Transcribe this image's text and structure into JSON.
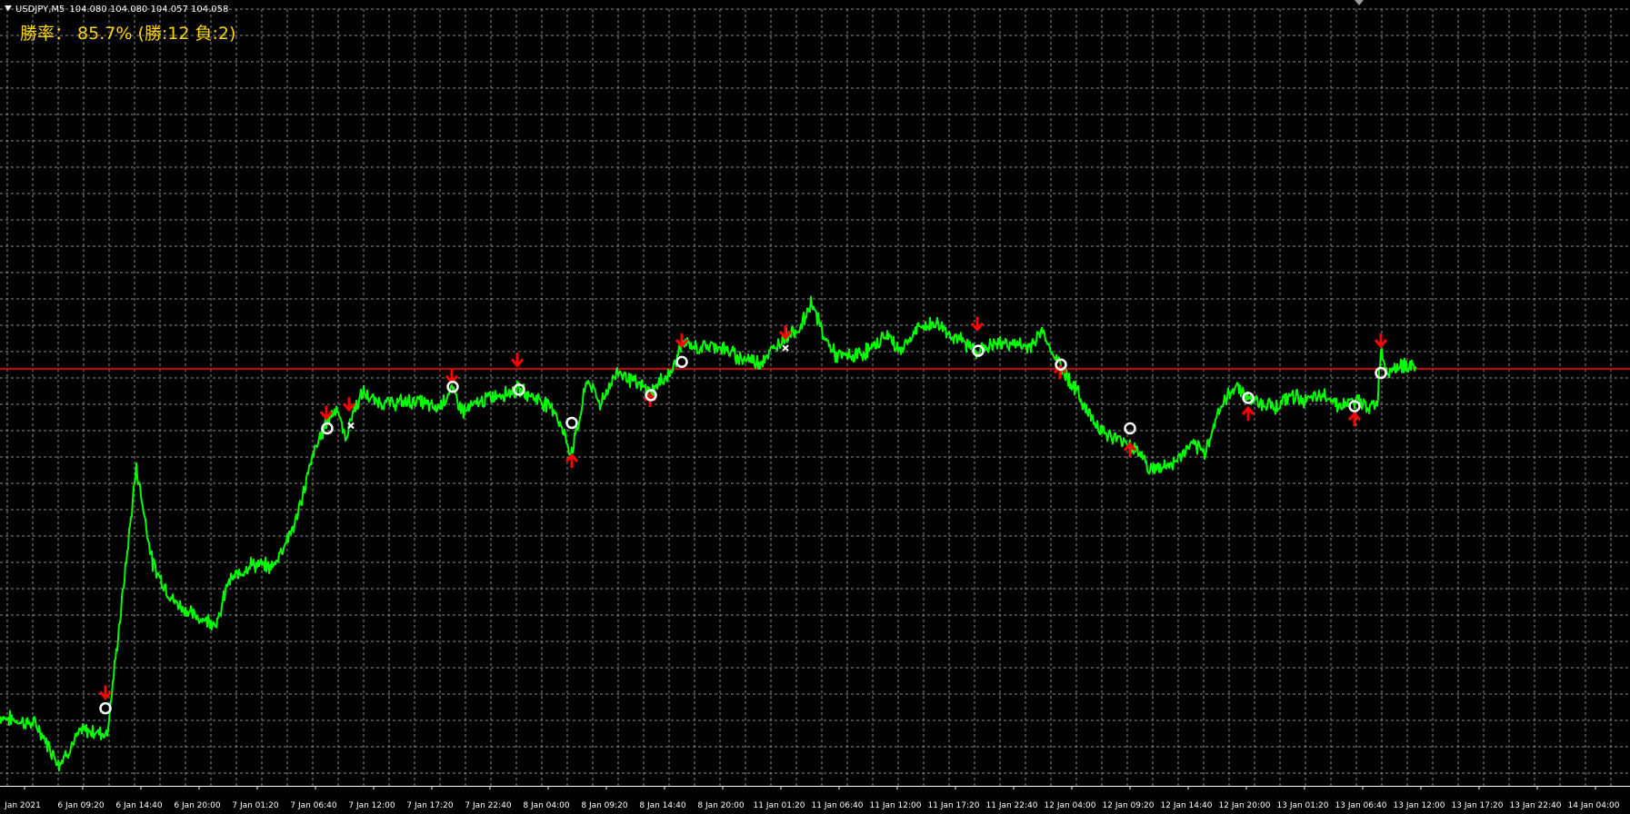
{
  "window": {
    "symbol_label": "USDJPY,M5",
    "ohlc_label": "104.080 104.080 104.057 104.058"
  },
  "overlay": {
    "win_rate_text": "勝率： 85.7% (勝:12  負:2)"
  },
  "colors": {
    "background": "#000000",
    "grid": "#8c8c8c",
    "price_line": "#00ff00",
    "bid_line": "#c80000",
    "sell_arrow": "#ff0000",
    "buy_arrow": "#ff0000",
    "win_marker": "#ffffff",
    "loss_marker": "#ffffff",
    "title_text": "#ffffff",
    "winrate_text": "#ffd700",
    "axis_text": "#ffffff"
  },
  "chart_data": {
    "type": "line",
    "symbol": "USDJPY",
    "timeframe": "M5",
    "x_tick_labels": [
      "Jan 2021",
      "6 Jan 09:20",
      "6 Jan 14:40",
      "6 Jan 20:00",
      "7 Jan 01:20",
      "7 Jan 06:40",
      "7 Jan 12:00",
      "7 Jan 17:20",
      "7 Jan 22:40",
      "8 Jan 04:00",
      "8 Jan 09:20",
      "8 Jan 14:40",
      "8 Jan 20:00",
      "11 Jan 01:20",
      "11 Jan 06:40",
      "11 Jan 12:00",
      "11 Jan 17:20",
      "11 Jan 22:40",
      "12 Jan 04:00",
      "12 Jan 09:20",
      "12 Jan 14:40",
      "12 Jan 20:00",
      "13 Jan 01:20",
      "13 Jan 06:40",
      "13 Jan 12:00",
      "13 Jan 17:20",
      "13 Jan 22:40",
      "14 Jan 04:00"
    ],
    "y_scale": {
      "min": 102.55,
      "max": 104.35,
      "bid": 104.058
    },
    "series": [
      {
        "values": [
          [
            0,
            102.8
          ],
          [
            40,
            102.77
          ],
          [
            65,
            102.63
          ],
          [
            90,
            102.75
          ],
          [
            118,
            102.74
          ],
          [
            132,
            103.15
          ],
          [
            150,
            103.7
          ],
          [
            168,
            103.35
          ],
          [
            190,
            103.22
          ],
          [
            215,
            103.16
          ],
          [
            240,
            103.14
          ],
          [
            250,
            103.28
          ],
          [
            275,
            103.35
          ],
          [
            300,
            103.34
          ],
          [
            325,
            103.5
          ],
          [
            345,
            103.75
          ],
          [
            360,
            103.87
          ],
          [
            370,
            103.92
          ],
          [
            380,
            103.8
          ],
          [
            388,
            103.9
          ],
          [
            400,
            103.97
          ],
          [
            410,
            103.94
          ],
          [
            430,
            103.93
          ],
          [
            460,
            103.94
          ],
          [
            480,
            103.91
          ],
          [
            497,
            103.98
          ],
          [
            510,
            103.9
          ],
          [
            525,
            103.93
          ],
          [
            545,
            103.96
          ],
          [
            570,
            103.98
          ],
          [
            590,
            103.95
          ],
          [
            610,
            103.91
          ],
          [
            628,
            103.75
          ],
          [
            636,
            103.85
          ],
          [
            646,
            104.02
          ],
          [
            660,
            103.93
          ],
          [
            680,
            104.05
          ],
          [
            700,
            104.0
          ],
          [
            716,
            103.97
          ],
          [
            730,
            104.02
          ],
          [
            740,
            104.05
          ],
          [
            750,
            104.15
          ],
          [
            765,
            104.13
          ],
          [
            790,
            104.14
          ],
          [
            810,
            104.1
          ],
          [
            835,
            104.08
          ],
          [
            850,
            104.12
          ],
          [
            865,
            104.18
          ],
          [
            880,
            104.2
          ],
          [
            893,
            104.3
          ],
          [
            905,
            104.18
          ],
          [
            920,
            104.1
          ],
          [
            940,
            104.1
          ],
          [
            960,
            104.13
          ],
          [
            975,
            104.18
          ],
          [
            990,
            104.12
          ],
          [
            1010,
            104.2
          ],
          [
            1030,
            104.22
          ],
          [
            1045,
            104.18
          ],
          [
            1060,
            104.15
          ],
          [
            1076,
            104.12
          ],
          [
            1090,
            104.14
          ],
          [
            1110,
            104.15
          ],
          [
            1130,
            104.13
          ],
          [
            1147,
            104.19
          ],
          [
            1160,
            104.1
          ],
          [
            1170,
            104.05
          ],
          [
            1185,
            103.97
          ],
          [
            1200,
            103.88
          ],
          [
            1220,
            103.81
          ],
          [
            1240,
            103.79
          ],
          [
            1255,
            103.75
          ],
          [
            1265,
            103.69
          ],
          [
            1290,
            103.71
          ],
          [
            1310,
            103.78
          ],
          [
            1325,
            103.75
          ],
          [
            1340,
            103.9
          ],
          [
            1360,
            104.0
          ],
          [
            1373,
            103.95
          ],
          [
            1390,
            103.93
          ],
          [
            1405,
            103.92
          ],
          [
            1420,
            103.96
          ],
          [
            1440,
            103.94
          ],
          [
            1460,
            103.96
          ],
          [
            1475,
            103.92
          ],
          [
            1490,
            103.94
          ],
          [
            1505,
            103.92
          ],
          [
            1515,
            103.93
          ],
          [
            1519,
            104.13
          ],
          [
            1525,
            104.05
          ],
          [
            1535,
            104.06
          ],
          [
            1545,
            104.07
          ],
          [
            1558,
            104.058
          ]
        ]
      }
    ],
    "signals": [
      {
        "type": "sell",
        "x": 116,
        "y": 102.86
      },
      {
        "type": "sell",
        "x": 359,
        "y": 103.87
      },
      {
        "type": "sell",
        "x": 384,
        "y": 103.9
      },
      {
        "type": "sell",
        "x": 497,
        "y": 104.0
      },
      {
        "type": "sell",
        "x": 569,
        "y": 104.06
      },
      {
        "type": "buy",
        "x": 629,
        "y": 103.75
      },
      {
        "type": "buy",
        "x": 715,
        "y": 103.97
      },
      {
        "type": "sell",
        "x": 750,
        "y": 104.13
      },
      {
        "type": "sell",
        "x": 864,
        "y": 104.16
      },
      {
        "type": "sell",
        "x": 1075,
        "y": 104.19
      },
      {
        "type": "buy",
        "x": 1166,
        "y": 104.07
      },
      {
        "type": "buy",
        "x": 1243,
        "y": 103.79
      },
      {
        "type": "buy",
        "x": 1373,
        "y": 103.92
      },
      {
        "type": "buy",
        "x": 1490,
        "y": 103.9
      },
      {
        "type": "sell",
        "x": 1519,
        "y": 104.13
      }
    ],
    "results": [
      {
        "result": "win",
        "x": 116,
        "y": 102.83
      },
      {
        "result": "win",
        "x": 360,
        "y": 103.84
      },
      {
        "result": "loss",
        "x": 386,
        "y": 103.85
      },
      {
        "result": "win",
        "x": 498,
        "y": 103.99
      },
      {
        "result": "win",
        "x": 571,
        "y": 103.98
      },
      {
        "result": "win",
        "x": 629,
        "y": 103.86
      },
      {
        "result": "win",
        "x": 716,
        "y": 103.96
      },
      {
        "result": "win",
        "x": 750,
        "y": 104.08
      },
      {
        "result": "loss",
        "x": 864,
        "y": 104.13
      },
      {
        "result": "win",
        "x": 1076,
        "y": 104.12
      },
      {
        "result": "win",
        "x": 1167,
        "y": 104.07
      },
      {
        "result": "win",
        "x": 1243,
        "y": 103.84
      },
      {
        "result": "win",
        "x": 1373,
        "y": 103.95
      },
      {
        "result": "win",
        "x": 1490,
        "y": 103.92
      },
      {
        "result": "win",
        "x": 1519,
        "y": 104.04
      }
    ]
  }
}
